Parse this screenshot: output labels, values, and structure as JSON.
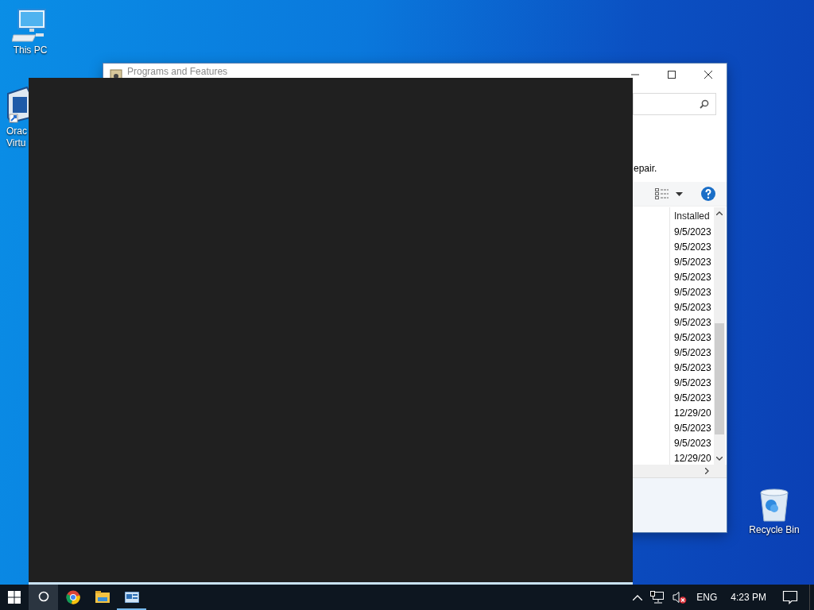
{
  "desktop_icons": [
    {
      "kind": "pc",
      "label_lines": [
        "This PC"
      ]
    },
    {
      "kind": "virtualbox",
      "label_lines": [
        "Orac",
        "Virtu"
      ]
    },
    {
      "kind": "recycle",
      "label_lines": [
        "Recycle Bin"
      ]
    }
  ],
  "window": {
    "title": "Programs and Features",
    "description": "epair.",
    "list": {
      "columns": [
        "Installed"
      ],
      "rows": [
        [
          "9/5/2023"
        ],
        [
          "9/5/2023"
        ],
        [
          "9/5/2023"
        ],
        [
          "9/5/2023"
        ],
        [
          "9/5/2023"
        ],
        [
          "9/5/2023"
        ],
        [
          "9/5/2023"
        ],
        [
          "9/5/2023"
        ],
        [
          "9/5/2023"
        ],
        [
          "9/5/2023"
        ],
        [
          "9/5/2023"
        ],
        [
          "9/5/2023"
        ],
        [
          "12/29/20"
        ],
        [
          "9/5/2023"
        ],
        [
          "9/5/2023"
        ],
        [
          "12/29/20"
        ]
      ]
    }
  },
  "taskbar": {
    "items": [
      {
        "kind": "start",
        "highlighted": false,
        "running": false
      },
      {
        "kind": "search",
        "highlighted": true,
        "running": false
      },
      {
        "kind": "chrome",
        "highlighted": false,
        "running": false
      },
      {
        "kind": "explorer",
        "highlighted": false,
        "running": false
      },
      {
        "kind": "virtualbox",
        "highlighted": false,
        "running": true
      }
    ],
    "tray": {
      "volume_muted": true,
      "language": "ENG",
      "time": "4:23 PM"
    }
  }
}
